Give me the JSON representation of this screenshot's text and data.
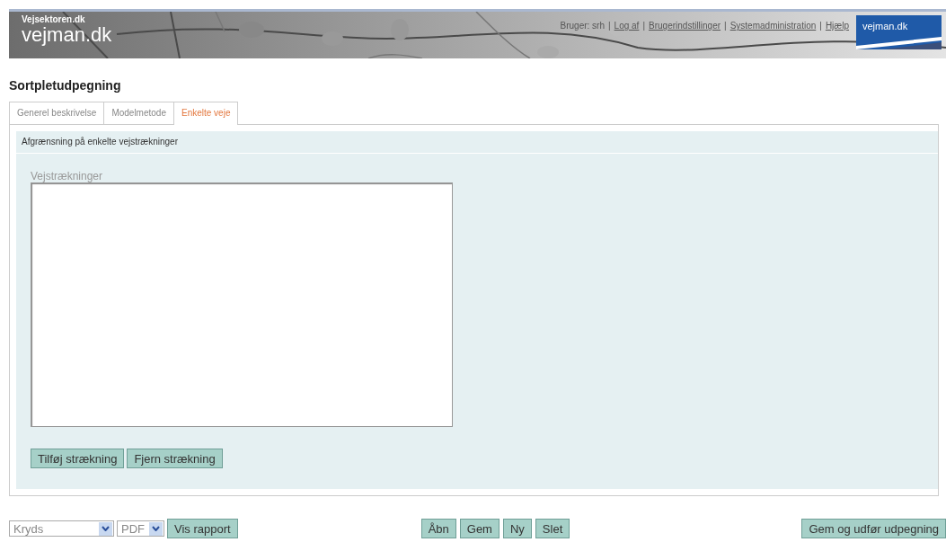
{
  "header": {
    "site": "Vejsektoren.dk",
    "brand": "vejman.dk",
    "user_nav": [
      {
        "kind": "text",
        "text": "Bruger: srh"
      },
      {
        "kind": "separator",
        "text": "|"
      },
      {
        "kind": "link",
        "text": "Log af"
      },
      {
        "kind": "separator",
        "text": "|"
      },
      {
        "kind": "link",
        "text": "Brugerindstillinger"
      },
      {
        "kind": "separator",
        "text": "|"
      },
      {
        "kind": "link",
        "text": "Systemadministration"
      },
      {
        "kind": "separator",
        "text": "|"
      },
      {
        "kind": "link",
        "text": "Hjælp"
      }
    ],
    "logo": {
      "text": "vejman.dk"
    }
  },
  "page_title": "Sortpletudpegning",
  "tabs": [
    {
      "label": "Generel beskrivelse",
      "selected": false
    },
    {
      "label": "Modelmetode",
      "selected": false
    },
    {
      "label": "Enkelte veje",
      "selected": true
    }
  ],
  "panel": {
    "heading": "Afgrænsning på enkelte vejstrækninger",
    "list_label": "Vejstrækninger",
    "buttons": [
      "Tilføj strækning",
      "Fjern strækning"
    ]
  },
  "footer": {
    "selects": [
      {
        "value": "Kryds"
      },
      {
        "value": "PDF"
      }
    ],
    "report_button": "Vis rapport",
    "middle_buttons": [
      "Åbn",
      "Gem",
      "Ny",
      "Slet"
    ],
    "main_button": "Gem og udfør udpegning"
  }
}
